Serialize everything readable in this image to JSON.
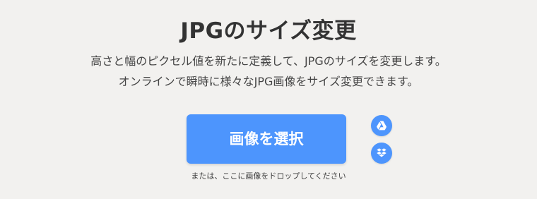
{
  "hero": {
    "title": "JPGのサイズ変更",
    "description_line1": "高さと幅のピクセル値を新たに定義して、JPGのサイズを変更します。",
    "description_line2": "オンラインで瞬時に様々なJPG画像をサイズ変更できます。"
  },
  "upload": {
    "button_label": "画像を選択",
    "drop_hint": "または、ここに画像をドロップしてください"
  },
  "cloud": {
    "gdrive_icon": "google-drive-icon",
    "dropbox_icon": "dropbox-icon"
  },
  "colors": {
    "background": "#f2f1ef",
    "accent": "#4d95fd",
    "text": "#333333"
  }
}
